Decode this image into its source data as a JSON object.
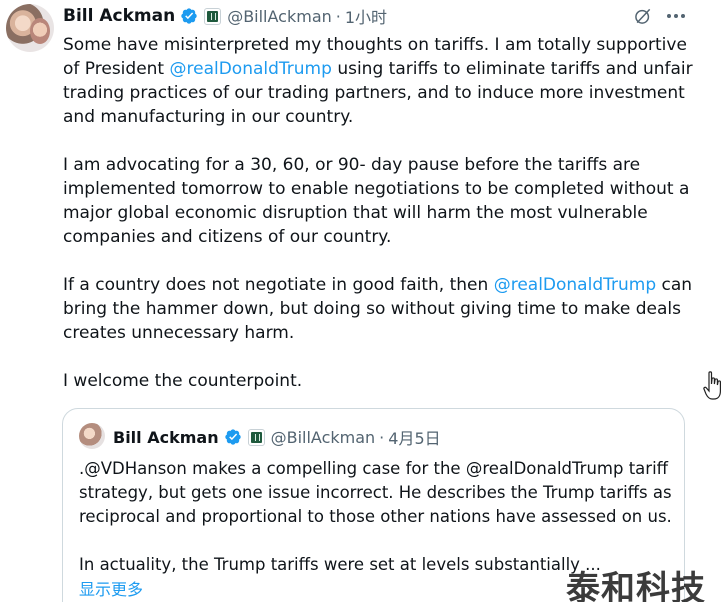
{
  "tweet": {
    "author_name": "Bill Ackman",
    "handle": "@BillAckman",
    "separator": "·",
    "time": "1小时",
    "paragraphs": {
      "p1_a": "Some have misinterpreted my thoughts on tariffs. I am totally supportive of President ",
      "p1_mention": "@realDonaldTrump",
      "p1_b": " using tariffs to eliminate tariffs and unfair trading practices of our trading partners, and to induce more investment and manufacturing in our country.",
      "p2": "I am advocating for a 30, 60, or 90- day pause before the tariffs are implemented tomorrow to enable negotiations to be completed without a major global economic disruption that will harm the most vulnerable companies and citizens of our country.",
      "p3_a": "If a country does not negotiate in good faith, then ",
      "p3_mention": "@realDonaldTrump",
      "p3_b": " can bring the hammer down, but doing so without giving time to make deals creates unnecessary harm.",
      "p4": "I welcome the counterpoint."
    }
  },
  "quote": {
    "author_name": "Bill Ackman",
    "handle": "@BillAckman",
    "separator": "·",
    "time": "4月5日",
    "p1": ".@VDHanson makes a compelling case for the @realDonaldTrump tariff strategy, but gets one issue incorrect. He describes the Trump tariffs as reciprocal and proportional to those other nations have assessed on us.",
    "p2": "In actuality, the Trump tariffs were set at levels substantially ...",
    "show_more": "显示更多"
  },
  "watermark": "泰和科技",
  "icons": {
    "verified": "verified-badge-icon",
    "affiliate": "affiliate-badge-icon",
    "grok": "grok-icon",
    "more": "more-options-icon",
    "cursor": "hand-cursor-icon"
  },
  "colors": {
    "accent": "#1d9bf0",
    "text": "#0f1419",
    "secondary": "#536471",
    "border": "#cfd9de"
  }
}
